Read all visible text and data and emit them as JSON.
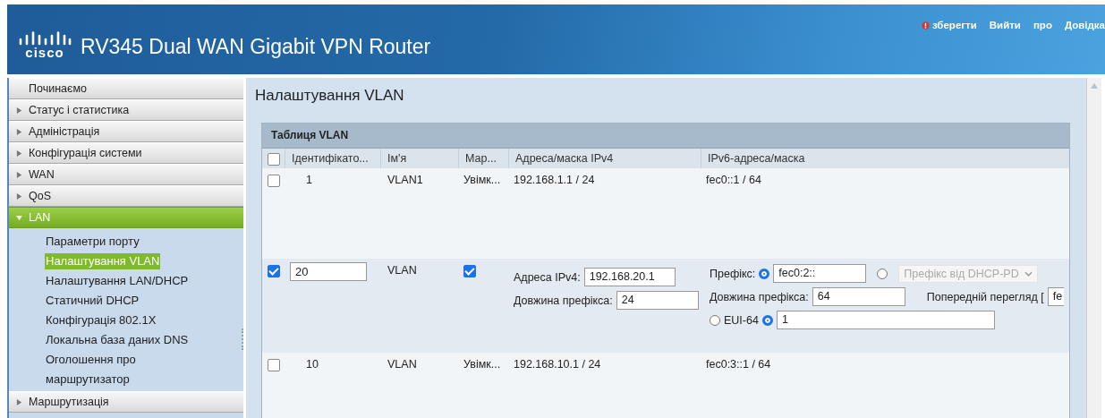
{
  "header": {
    "logo_text": "cisco",
    "title": "RV345 Dual WAN Gigabit VPN Router",
    "links": [
      {
        "kind": "save",
        "label": "зберегти"
      },
      {
        "kind": "plain",
        "label": "Вийти"
      },
      {
        "kind": "plain",
        "label": "про"
      },
      {
        "kind": "plain",
        "label": "Довідка"
      }
    ]
  },
  "sidebar": {
    "items": [
      {
        "label": "Починаємо",
        "kind": "leaf",
        "selected": false
      },
      {
        "label": "Статус і статистика",
        "kind": "group",
        "expanded": false,
        "selected": false
      },
      {
        "label": "Адміністрація",
        "kind": "group",
        "expanded": false,
        "selected": false
      },
      {
        "label": "Конфігурація системи",
        "kind": "group",
        "expanded": false,
        "selected": false
      },
      {
        "label": "WAN",
        "kind": "group",
        "expanded": false,
        "selected": false
      },
      {
        "label": "QoS",
        "kind": "group",
        "expanded": false,
        "selected": false
      },
      {
        "label": "LAN",
        "kind": "group",
        "expanded": true,
        "selected": true,
        "children": [
          {
            "label": "Параметри порту",
            "selected": false
          },
          {
            "label": "Налаштування VLAN",
            "selected": true
          },
          {
            "label": "Налаштування LAN/DHCP",
            "selected": false
          },
          {
            "label": "Статичний DHCP",
            "selected": false
          },
          {
            "label": "Конфігурація 802.1X",
            "selected": false
          },
          {
            "label": "Локальна база даних DNS",
            "selected": false
          },
          {
            "label": "Оголошення про маршрутизатор",
            "selected": false
          }
        ]
      },
      {
        "label": "Маршрутизація",
        "kind": "group",
        "expanded": false,
        "selected": false
      }
    ]
  },
  "page_title": "Налаштування VLAN",
  "table": {
    "title": "Таблиця VLAN",
    "select_all_checked": false,
    "columns": [
      "Ідентифікато...",
      "Ім'я",
      "Мар...",
      "Адреса/маска IPv4",
      "IPv6-адреса/маска"
    ],
    "rows": [
      {
        "kind": "view",
        "checked": false,
        "id": "1",
        "name": "VLAN1",
        "mark": "Увімк...",
        "ipv4": "192.168.1.1 / 24",
        "ipv6": "fec0::1 / 64"
      },
      {
        "kind": "edit",
        "checked": true,
        "id": "20",
        "name": "VLAN",
        "mark_checked": true,
        "ipv4": {
          "address_label": "Адреса IPv4:",
          "address_value": "192.168.20.1",
          "length_label": "Довжина префікса:",
          "length_value": "24"
        },
        "ipv6": {
          "prefix_label": "Префікс:",
          "prefix_radio_selected": true,
          "prefix_value": "fec0:2::",
          "dhcp_radio_selected": false,
          "dhcp_select": "Префікс від DHCP-PD",
          "dhcp_select_disabled": true,
          "length_label": "Довжина префікса:",
          "length_value": "64",
          "preview_label": "Попередній перегляд [",
          "preview_value": "fe",
          "eui_radio_selected": false,
          "eui_label": "EUI-64",
          "host_radio_selected": true,
          "host_value": "1"
        }
      },
      {
        "kind": "view",
        "checked": false,
        "id": "10",
        "name": "VLAN",
        "mark": "Увімк...",
        "ipv4": "192.168.10.1 / 24",
        "ipv6": "fec0:3::1 / 64"
      }
    ]
  }
}
